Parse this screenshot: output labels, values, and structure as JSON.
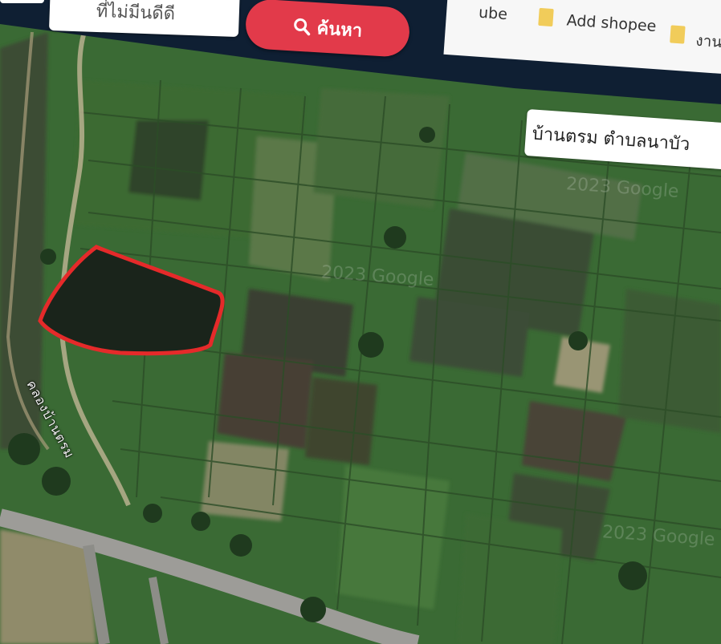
{
  "search": {
    "placeholder_partial": "ที่ไม่มีนดีดี",
    "button_label": "ค้นหา"
  },
  "bookmarks": [
    {
      "label": "ube"
    },
    {
      "label": "Add shopee"
    },
    {
      "label": "งาน"
    }
  ],
  "map": {
    "place_label": "บ้านตรม ตำบลนาบัว",
    "canal_label": "คลองบ้านตรม",
    "watermark": "2023 Google"
  },
  "colors": {
    "header": "#0f1f33",
    "search_button": "#e23a4a",
    "highlight": "#e52a2a",
    "field_green": "#3d6b35"
  }
}
